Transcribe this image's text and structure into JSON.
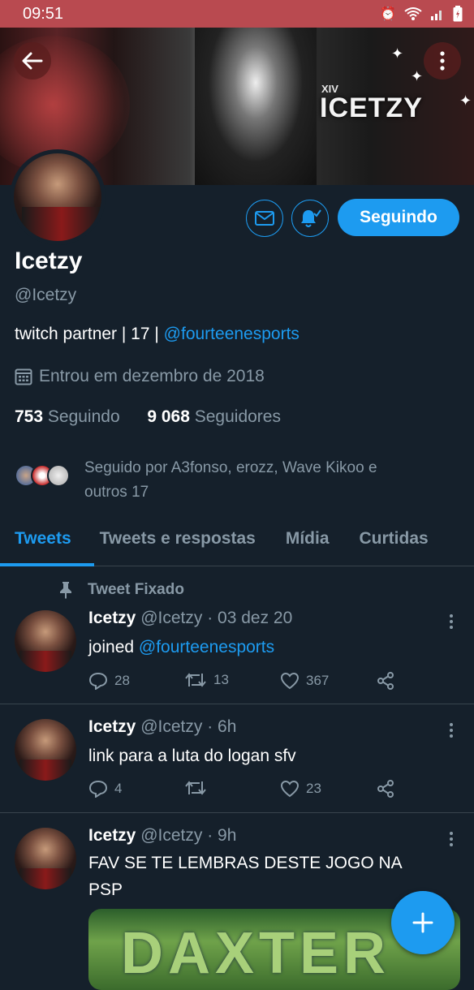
{
  "status_bar": {
    "time": "09:51",
    "icons": [
      "alarm-icon",
      "wifi-icon",
      "signal-icon",
      "battery-icon"
    ]
  },
  "banner": {
    "logo_sub": "XIV",
    "logo": "ICETZY"
  },
  "profile": {
    "name": "Icetzy",
    "handle": "@Icetzy",
    "follow_button": "Seguindo",
    "bio_prefix": "twitch partner | 17 | ",
    "bio_link": "@fourteenesports",
    "joined": "Entrou em dezembro de 2018",
    "following_count": "753",
    "following_label": "Seguindo",
    "followers_count": "9 068",
    "followers_label": "Seguidores",
    "followed_by_line1": "Seguido por A3fonso, erozz, Wave Kikoo e",
    "followed_by_line2": "outros 17"
  },
  "tabs": [
    "Tweets",
    "Tweets e respostas",
    "Mídia",
    "Curtidas"
  ],
  "pinned_label": "Tweet Fixado",
  "tweets": [
    {
      "name": "Icetzy",
      "meta": "@Icetzy · 03 dez 20",
      "text_prefix": "joined ",
      "text_link": "@fourteenesports",
      "replies": "28",
      "retweets": "13",
      "likes": "367"
    },
    {
      "name": "Icetzy",
      "meta": "@Icetzy · 6h",
      "text": "link para a luta do logan sfv",
      "replies": "4",
      "retweets": "",
      "likes": "23"
    },
    {
      "name": "Icetzy",
      "meta": "@Icetzy · 9h",
      "text_line1": "FAV SE TE LEMBRAS DESTE JOGO NA",
      "text_line2": "PSP",
      "media_text": "DAXTER"
    }
  ],
  "colors": {
    "accent": "#1d9bf0",
    "background": "#15202b",
    "muted": "#8899a6",
    "status_bar": "#b94a50"
  }
}
